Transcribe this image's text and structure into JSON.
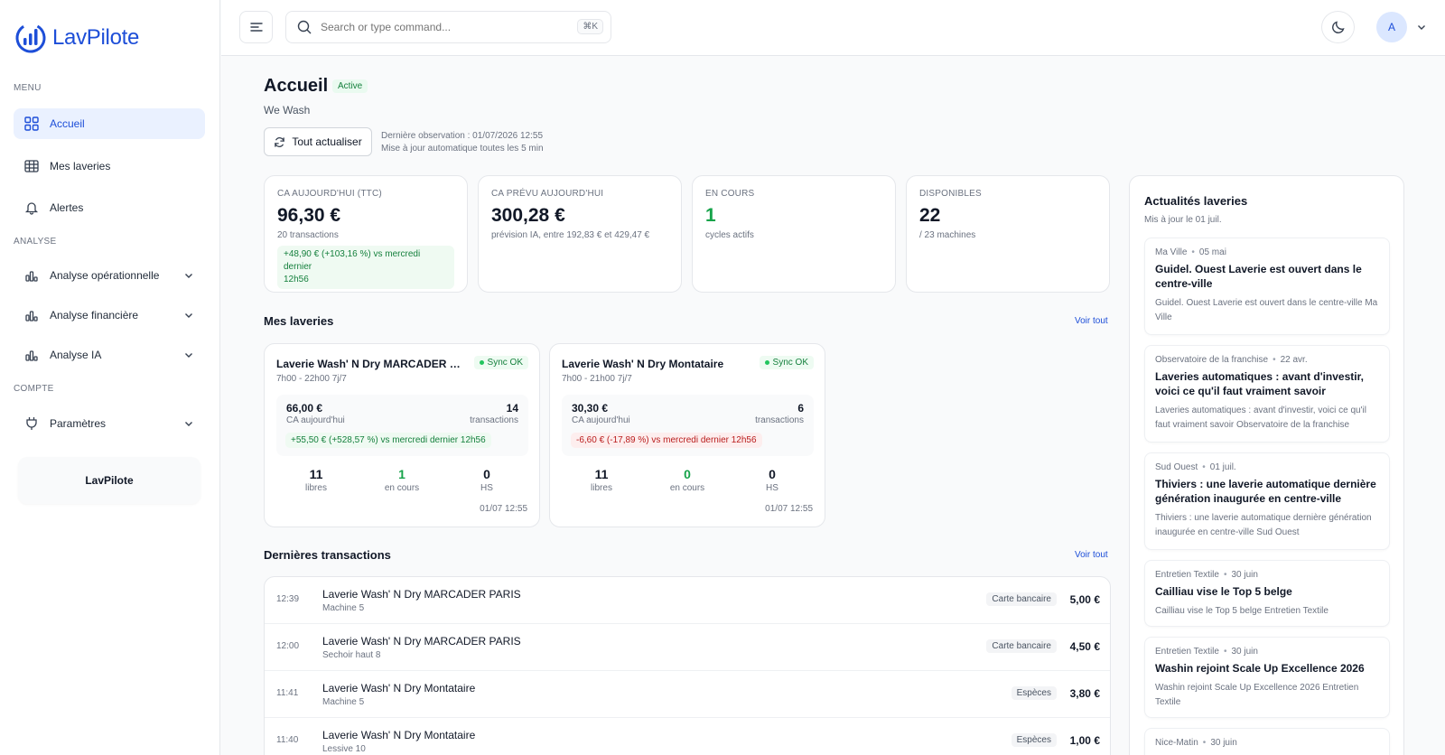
{
  "brand": {
    "name": "LavPilote",
    "color": "#1d4ed8"
  },
  "sidebar": {
    "sections": {
      "menu": "MENU",
      "analyse": "ANALYSE",
      "compte": "COMPTE"
    },
    "items": [
      {
        "label": "Accueil",
        "icon": "grid-icon",
        "active": true
      },
      {
        "label": "Mes laveries",
        "icon": "table-icon"
      },
      {
        "label": "Alertes",
        "icon": "bell-icon"
      },
      {
        "label": "Analyse opérationnelle",
        "icon": "bar-chart-icon"
      },
      {
        "label": "Analyse financière",
        "icon": "bar-chart-icon"
      },
      {
        "label": "Analyse IA",
        "icon": "bar-chart-icon"
      },
      {
        "label": "Paramètres",
        "icon": "plug-icon"
      }
    ],
    "brand_box": "LavPilote"
  },
  "topbar": {
    "search_placeholder": "Search or type command...",
    "shortcut": "⌘K",
    "avatar": "A"
  },
  "header": {
    "title": "Accueil",
    "badge": "Active",
    "subtitle": "We Wash",
    "refresh_label": "Tout actualiser",
    "observation": "Dernière observation : 01/07/2026 12:55",
    "auto_update": "Mise à jour automatique toutes les 5 min"
  },
  "kpis": [
    {
      "label": "CA AUJOURD'HUI (TTC)",
      "value": "96,30 €",
      "sub": "20 transactions",
      "delta_line1": "+48,90 € (+103,16 %) vs mercredi dernier",
      "delta_line2": "12h56"
    },
    {
      "label": "CA PRÉVU AUJOURD'HUI",
      "value": "300,28 €",
      "sub": "prévision IA, entre 192,83 € et 429,47 €"
    },
    {
      "label": "EN COURS",
      "value": "1",
      "sub": "cycles actifs"
    },
    {
      "label": "DISPONIBLES",
      "value": "22",
      "sub": "/ 23 machines"
    }
  ],
  "laundries_section": {
    "title": "Mes laveries",
    "see_all": "Voir tout"
  },
  "laundries": [
    {
      "name": "Laverie Wash' N Dry MARCADER PARIS",
      "sync": "Sync OK",
      "hours": "7h00 - 22h00 7j/7",
      "amount": "66,00 €",
      "amount_label": "CA aujourd'hui",
      "tx": "14",
      "tx_label": "transactions",
      "delta": "+55,50 € (+528,57 %) vs mercredi dernier 12h56",
      "delta_type": "pos",
      "free": "11",
      "free_label": "libres",
      "running": "1",
      "running_label": "en cours",
      "hs": "0",
      "hs_label": "HS",
      "time": "01/07 12:55"
    },
    {
      "name": "Laverie Wash' N Dry Montataire",
      "sync": "Sync OK",
      "hours": "7h00 - 21h00 7j/7",
      "amount": "30,30 €",
      "amount_label": "CA aujourd'hui",
      "tx": "6",
      "tx_label": "transactions",
      "delta": "-6,60 € (-17,89 %) vs mercredi dernier 12h56",
      "delta_type": "neg",
      "free": "11",
      "free_label": "libres",
      "running": "0",
      "running_label": "en cours",
      "hs": "0",
      "hs_label": "HS",
      "time": "01/07 12:55"
    }
  ],
  "transactions_section": {
    "title": "Dernières transactions",
    "see_all": "Voir tout"
  },
  "transactions": [
    {
      "time": "12:39",
      "name": "Laverie Wash' N Dry MARCADER PARIS",
      "machine": "Machine 5",
      "method": "Carte bancaire",
      "amount": "5,00 €"
    },
    {
      "time": "12:00",
      "name": "Laverie Wash' N Dry MARCADER PARIS",
      "machine": "Sechoir haut 8",
      "method": "Carte bancaire",
      "amount": "4,50 €"
    },
    {
      "time": "11:41",
      "name": "Laverie Wash' N Dry Montataire",
      "machine": "Machine 5",
      "method": "Espèces",
      "amount": "3,80 €"
    },
    {
      "time": "11:40",
      "name": "Laverie Wash' N Dry Montataire",
      "machine": "Lessive 10",
      "method": "Espèces",
      "amount": "1,00 €"
    }
  ],
  "news": {
    "title": "Actualités laveries",
    "subtitle": "Mis à jour le 01 juil.",
    "items": [
      {
        "source": "Ma Ville",
        "date": "05 mai",
        "title": "Guidel. Ouest Laverie est ouvert dans le centre-ville",
        "body": "Guidel. Ouest Laverie est ouvert dans le centre-ville Ma Ville"
      },
      {
        "source": "Observatoire de la franchise",
        "date": "22 avr.",
        "title": "Laveries automatiques : avant d'investir, voici ce qu'il faut vraiment savoir",
        "body": "Laveries automatiques : avant d'investir, voici ce qu'il faut vraiment savoir Observatoire de la franchise"
      },
      {
        "source": "Sud Ouest",
        "date": "01 juil.",
        "title": "Thiviers : une laverie automatique dernière génération inaugurée en centre-ville",
        "body": "Thiviers : une laverie automatique dernière génération inaugurée en centre-ville Sud Ouest"
      },
      {
        "source": "Entretien Textile",
        "date": "30 juin",
        "title": "Cailliau vise le Top 5 belge",
        "body": "Cailliau vise le Top 5 belge Entretien Textile"
      },
      {
        "source": "Entretien Textile",
        "date": "30 juin",
        "title": "Washin rejoint Scale Up Excellence 2026",
        "body": "Washin rejoint Scale Up Excellence 2026 Entretien Textile"
      },
      {
        "source": "Nice-Matin",
        "date": "30 juin"
      }
    ]
  }
}
